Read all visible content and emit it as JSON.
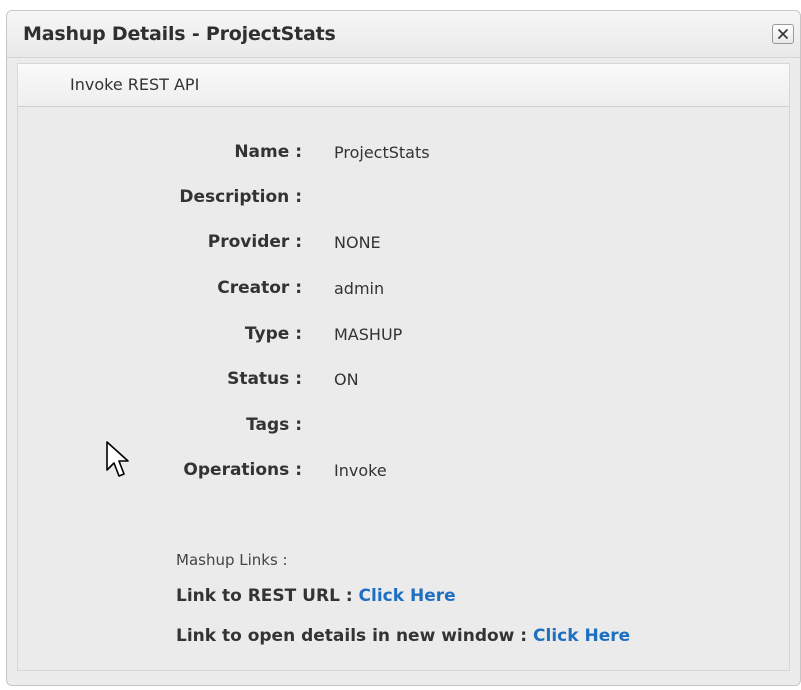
{
  "dialog": {
    "title": "Mashup Details - ProjectStats",
    "close_glyph": "✕"
  },
  "toolbar": {
    "invoke_label": "Invoke REST API"
  },
  "details": [
    {
      "label": "Name :",
      "value": "ProjectStats"
    },
    {
      "label": "Description :",
      "value": ""
    },
    {
      "label": "Provider :",
      "value": "NONE"
    },
    {
      "label": "Creator :",
      "value": "admin"
    },
    {
      "label": "Type :",
      "value": "MASHUP"
    },
    {
      "label": "Status :",
      "value": "ON"
    },
    {
      "label": "Tags :",
      "value": ""
    },
    {
      "label": "Operations :",
      "value": "Invoke"
    }
  ],
  "links": {
    "heading": "Mashup Links :",
    "rest_label": "Link to REST URL : ",
    "rest_link": "Click Here",
    "window_label": "Link to open details in new window : ",
    "window_link": "Click Here"
  },
  "colors": {
    "link": "#1f6fc0",
    "panel": "#ececec"
  },
  "icons": {
    "close": "close-icon",
    "cursor": "mouse-pointer-icon"
  }
}
